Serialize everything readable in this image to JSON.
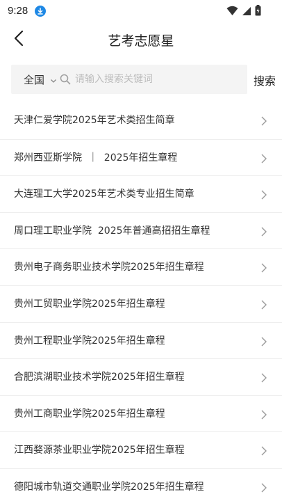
{
  "status_bar": {
    "time": "9:28",
    "icons": [
      "download-icon",
      "wifi-icon",
      "signal-icon",
      "battery-icon"
    ]
  },
  "header": {
    "back_icon": "chevron-left-icon",
    "title": "艺考志愿星"
  },
  "search": {
    "region": "全国",
    "placeholder": "请输入搜索关键词",
    "value": "",
    "button_label": "搜索"
  },
  "list": {
    "items": [
      {
        "title": "天津仁爱学院2025年艺术类招生简章"
      },
      {
        "title": "郑州西亚斯学院  ｜  2025年招生章程"
      },
      {
        "title": "大连理工大学2025年艺术类专业招生简章"
      },
      {
        "title": "周口理工职业学院  2025年普通高招招生章程"
      },
      {
        "title": "贵州电子商务职业技术学院2025年招生章程"
      },
      {
        "title": "贵州工贸职业学院2025年招生章程"
      },
      {
        "title": "贵州工程职业学院2025年招生章程"
      },
      {
        "title": "合肥滨湖职业技术学院2025年招生章程"
      },
      {
        "title": "贵州工商职业学院2025年招生章程"
      },
      {
        "title": "江西婺源茶业职业学院2025年招生章程"
      },
      {
        "title": "德阳城市轨道交通职业学院2025年招生章程"
      }
    ]
  },
  "colors": {
    "accent_badge": "#1e88e5",
    "divider": "#eeeeee",
    "search_bg": "#f4f4f4"
  }
}
